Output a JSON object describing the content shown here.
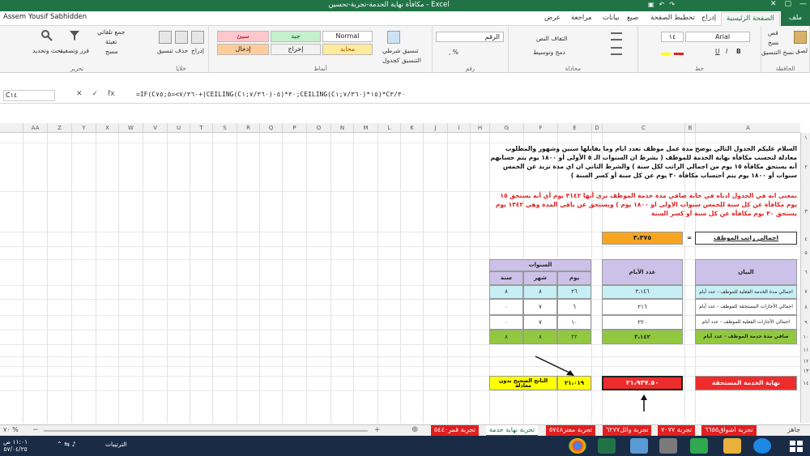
{
  "window": {
    "title": "مكافأة نهاية الخدمة-تجربة-تحسين - Excel",
    "user": "Assem Yousif Sabhidden"
  },
  "ribbon_tabs": [
    "ملف",
    "الصفحة الرئيسية",
    "إدراج",
    "تخطيط الصفحة",
    "صيغ",
    "بيانات",
    "مراجعة",
    "عرض"
  ],
  "ribbon": {
    "clipboard_label": "الحافظة",
    "paste": "لصق",
    "cut": "قص",
    "copy": "نسخ",
    "format_painter": "نسخ التنسيق",
    "font_label": "خط",
    "font_name": "Arial",
    "font_size": "١٤",
    "bold": "B",
    "italic": "I",
    "underline": "U",
    "alignment_label": "محاذاة",
    "wrap": "التفاف النص",
    "merge": "دمج وتوسيط",
    "number_label": "رقم",
    "number_format": "الرقم",
    "conditional": "تنسيق شرطي",
    "format_table": "التنسيق كجدول",
    "styles_label": "أنماط",
    "style_normal": "Normal",
    "style_good": "جيد",
    "style_bad": "سيئ",
    "style_neutral": "محايد",
    "style_input": "إدخال",
    "style_output": "إخراج",
    "cells_label": "خلايا",
    "insert": "إدراج",
    "delete": "حذف",
    "format": "تنسيق",
    "editing_label": "تحرير",
    "autosum": "جمع تلقائي",
    "fill": "تعبئة",
    "clear": "مسح",
    "sort": "فرز وتصفية",
    "find": "بحث وتحديد"
  },
  "formula_bar": {
    "name_box": "C١٤",
    "formula": "=IF(C٧/٣٦٠>=٥;٧٥+(CEILING(C٧/٣٦٠;١)-٥)*٣٠;CEILING(C٧/٣٦٠;١)*١٥)*C٣/٣٠"
  },
  "columns": [
    "A",
    "B",
    "C",
    "D",
    "E",
    "F",
    "G",
    "H",
    "I",
    "J",
    "K",
    "L",
    "M",
    "N",
    "O",
    "P",
    "Q",
    "R",
    "S",
    "T",
    "U",
    "V",
    "W",
    "X",
    "Y",
    "Z",
    "AA"
  ],
  "rows": [
    "١",
    "٢",
    "٣",
    "٤",
    "٥",
    "٦",
    "٧",
    "٨",
    "٩",
    "١٠",
    "١١",
    "١٢",
    "١٣",
    "١٤"
  ],
  "intro_text": "السلام عليكم الجدول التالي يوضح مدة عمل موظف تعدد ايام وما يقابلها سنين وشهور والمطلوب معادلة لتحسب مكافأة نهاية الخدمة للموظف ( بشرط ان السنوات الـ ٥ الأولى أو ١٨٠٠ يوم يتم حسابهم أنه يستحق مكافأة ١٥ يوم من اجمالي الراتب لكل سنة ) والشرط الثاني ان اي مدة تزيد عن الخمس سنوات أو ١٨٠٠ يوم يتم أحتساب مكافأة ٣٠ يوم عن كل سنة أو كسر السنة )",
  "note_text": "بمعنى انه في الجدول ادناه في خانة صافي مدة خدمة الموظف نرى أنها ٣١٤٢ يوم أي أنه يستحق ١٥ يوم مكافأة عن كل سنة للخمس سنوات الاولى او ١٨٠٠ يوم ) ويستحق عن باقي المدة وهي ١٣٤٢ يوم يستحق ٣٠ يوم مكافأة عن كل سنة أو كسر السنة",
  "salary": {
    "label": "اجمالي راتب الموظف",
    "eq": "=",
    "value": "٣،٣٧٥"
  },
  "table": {
    "header_statement": "البيان",
    "header_days": "عدد الأيام",
    "header_years_group": "السنوات",
    "header_day": "يوم",
    "header_month": "شهر",
    "header_year": "سنة",
    "rows": [
      {
        "label": "اجمالي مدة الخدمة الفعلية للموظف - عدد أيام",
        "days": "٣،١٤٦",
        "d": "٢٦",
        "m": "٨",
        "y": "٨"
      },
      {
        "label": "اجمالي الأجازات المستحقة للموظف - عدد أيام",
        "days": "٢١٦",
        "d": "٦",
        "m": "٧",
        "y": "٠"
      },
      {
        "label": "اجمالي الأجازات الفعلية للموظف - عدد أيام",
        "days": "٢٢٠",
        "d": "١٠",
        "m": "٧",
        "y": "٠"
      },
      {
        "label": "صافي مدة خدمة الموظف - عدد أيام",
        "days": "٣،١٤٢",
        "d": "٢٢",
        "m": "٨",
        "y": "٨"
      }
    ]
  },
  "result": {
    "label": "نهاية الخدمة المستحقة",
    "value": "٢١،٩٣٧.٥٠",
    "correct_value": "٢١،٠١٩",
    "correct_label": "الناتج الصحيح بدون معادلة"
  },
  "sheet_tabs": [
    "تجربة اشواق٦٦٥٥",
    "تجربة ٧٠٧٧",
    "تجربة وائل٦٢٧٧",
    "تجربة معتز٥٧٤٨",
    "تجربة نهاية خدمة",
    "تجربة قمر٥٤٤٠"
  ],
  "active_sheet_index": 4,
  "status": {
    "ready": "جاهز",
    "zoom": "٧٠ %"
  },
  "taskbar": {
    "time": "١١:٠١ ص",
    "date": "٥٧/٠٤/٢٥",
    "tray": "الترتيبات"
  }
}
